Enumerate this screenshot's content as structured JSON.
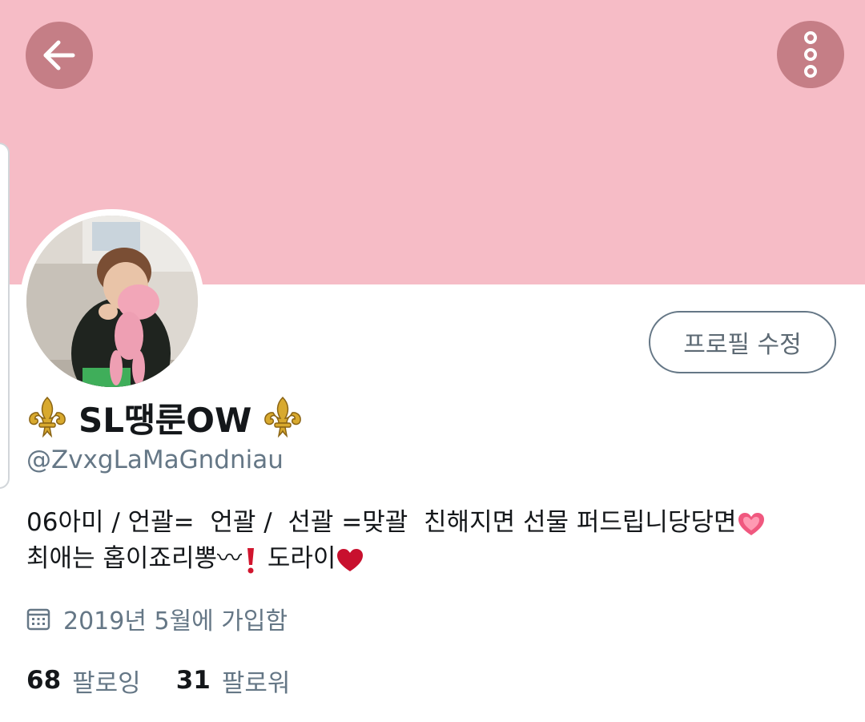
{
  "header": {
    "back_icon": "arrow-left-icon",
    "more_icon": "more-vertical-icon",
    "banner_color": "#f6bcc6",
    "button_color": "#c57e86"
  },
  "profile": {
    "display_name": "SL땡룬OW",
    "name_emoji": "fleur-de-lis",
    "handle": "@ZvxgLaMaGndniau",
    "edit_button_label": "프로필 수정",
    "bio_line1": "06아미 / 언괄=  언괄 /  선괄 =맞괄  친해지면 선물 퍼드립니당당면",
    "bio_line2_a": "최애는 홉이죠리뽕〰",
    "bio_line2_b": " 도라이",
    "joined": "2019년 5월에 가입함",
    "following_count": "68",
    "following_label": "팔로잉",
    "followers_count": "31",
    "followers_label": "팔로워"
  }
}
